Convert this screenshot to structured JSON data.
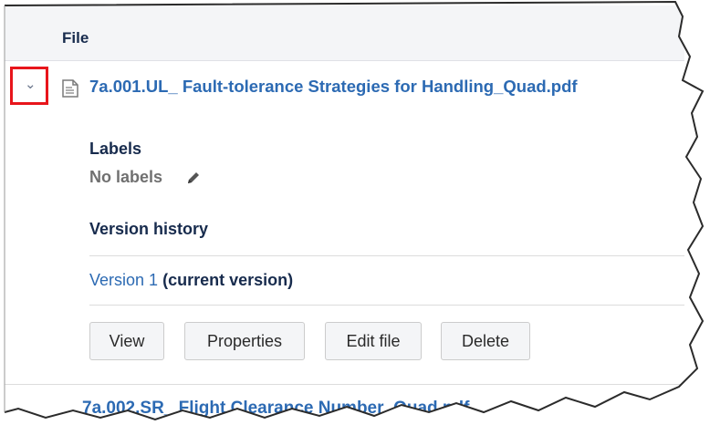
{
  "table": {
    "header_label": "File"
  },
  "attachment": {
    "file_name": "7a.001.UL_ Fault-tolerance Strategies for Handling_Quad.pdf",
    "labels_title": "Labels",
    "labels_value": "No labels",
    "version_history_title": "Version history",
    "version_link": "Version 1",
    "version_tag": "(current version)",
    "buttons": {
      "view": "View",
      "properties": "Properties",
      "edit_file": "Edit file",
      "delete": "Delete"
    }
  },
  "next_row": {
    "file_name_partial": "7a.002.SR_ Flight Clearance Number_Quad.pdf"
  },
  "colors": {
    "link": "#2c6ab3",
    "highlight_box": "#e8151b",
    "header_bg": "#f4f5f7",
    "button_bg": "#f4f5f7"
  },
  "icons": [
    "chevron-down-icon",
    "file-icon",
    "pencil-icon"
  ]
}
